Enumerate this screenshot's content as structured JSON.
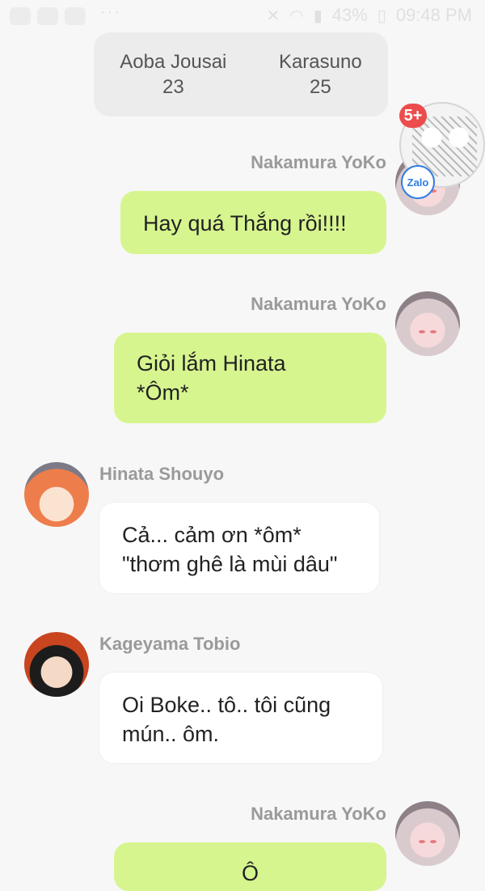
{
  "status": {
    "battery": "43%",
    "time": "09:48 PM",
    "dots": "···"
  },
  "score": {
    "team1": {
      "name": "Aoba Jousai",
      "score": "23"
    },
    "team2": {
      "name": "Karasuno",
      "score": "25"
    }
  },
  "chat_head": {
    "badge": "5+",
    "app": "Zalo"
  },
  "messages": [
    {
      "sender": "Nakamura YoKo",
      "text": "Hay quá Thắng rồi!!!!"
    },
    {
      "sender": "Nakamura YoKo",
      "text_line1": "Giỏi lắm Hinata",
      "text_line2": "*Ôm*"
    },
    {
      "sender": "Hinata Shouyo",
      "text_line1": "Cả... cảm ơn *ôm*",
      "text_line2": "\"thơm ghê là mùi dâu\""
    },
    {
      "sender": "Kageyama Tobio",
      "text_line1": "Oi Boke.. tô.. tôi cũng",
      "text_line2": "mún.. ôm."
    },
    {
      "sender": "Nakamura YoKo",
      "text": "Ô"
    }
  ]
}
